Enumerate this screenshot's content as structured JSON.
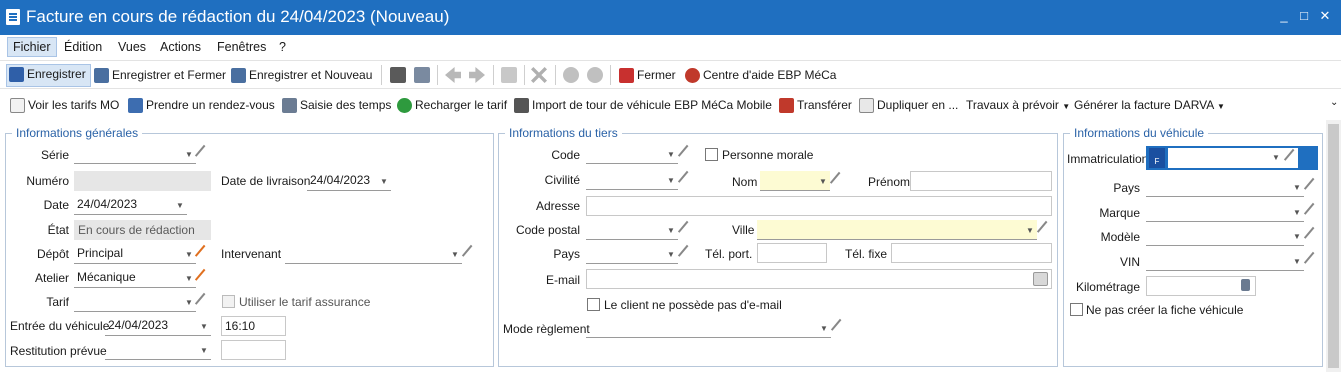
{
  "window": {
    "title": "Facture en cours de rédaction du 24/04/2023 (Nouveau)",
    "minimize": "_",
    "maximize": "□",
    "close": "✕"
  },
  "menu": {
    "items": [
      "Fichier",
      "Édition",
      "Vues",
      "Actions",
      "Fenêtres",
      "?"
    ]
  },
  "toolbar1": {
    "save": "Enregistrer",
    "save_close": "Enregistrer et Fermer",
    "save_new": "Enregistrer et Nouveau",
    "close": "Fermer",
    "help": "Centre d'aide EBP MéCa"
  },
  "toolbar2": {
    "tarifs_mo": "Voir les tarifs MO",
    "rdv": "Prendre un rendez-vous",
    "temps": "Saisie des temps",
    "recharger": "Recharger le tarif",
    "import_tour": "Import de tour de véhicule EBP MéCa Mobile",
    "transferer": "Transférer",
    "dupliquer": "Dupliquer en ...",
    "travaux": "Travaux à prévoir",
    "darva": "Générer la facture DARVA"
  },
  "general": {
    "title": "Informations générales",
    "serie_label": "Série",
    "numero_label": "Numéro",
    "livraison_label": "Date de livraison",
    "livraison_value": "24/04/2023",
    "date_label": "Date",
    "date_value": "24/04/2023",
    "etat_label": "État",
    "etat_value": "En cours de rédaction",
    "depot_label": "Dépôt",
    "depot_value": "Principal",
    "intervenant_label": "Intervenant",
    "atelier_label": "Atelier",
    "atelier_value": "Mécanique",
    "tarif_label": "Tarif",
    "tarif_assurance": "Utiliser le tarif assurance",
    "entree_label": "Entrée du véhicule",
    "entree_date": "24/04/2023",
    "entree_time": "16:10",
    "restitution_label": "Restitution prévue"
  },
  "tiers": {
    "title": "Informations du tiers",
    "code_label": "Code",
    "personne_morale": "Personne morale",
    "civilite_label": "Civilité",
    "nom_label": "Nom",
    "prenom_label": "Prénom",
    "adresse_label": "Adresse",
    "cp_label": "Code postal",
    "ville_label": "Ville",
    "pays_label": "Pays",
    "tel_port_label": "Tél. port.",
    "tel_fixe_label": "Tél. fixe",
    "email_label": "E-mail",
    "no_email": "Le client ne possède pas d'e-mail",
    "reglement_label": "Mode règlement"
  },
  "vehicule": {
    "title": "Informations du véhicule",
    "immat_label": "Immatriculation",
    "plate_letter": "F",
    "pays_label": "Pays",
    "marque_label": "Marque",
    "modele_label": "Modèle",
    "vin_label": "VIN",
    "km_label": "Kilométrage",
    "no_fiche": "Ne pas créer la fiche véhicule"
  },
  "colors": {
    "titlebar": "#1f6fc0",
    "group_title": "#2a62a7",
    "required_field": "#fdfbd3"
  }
}
